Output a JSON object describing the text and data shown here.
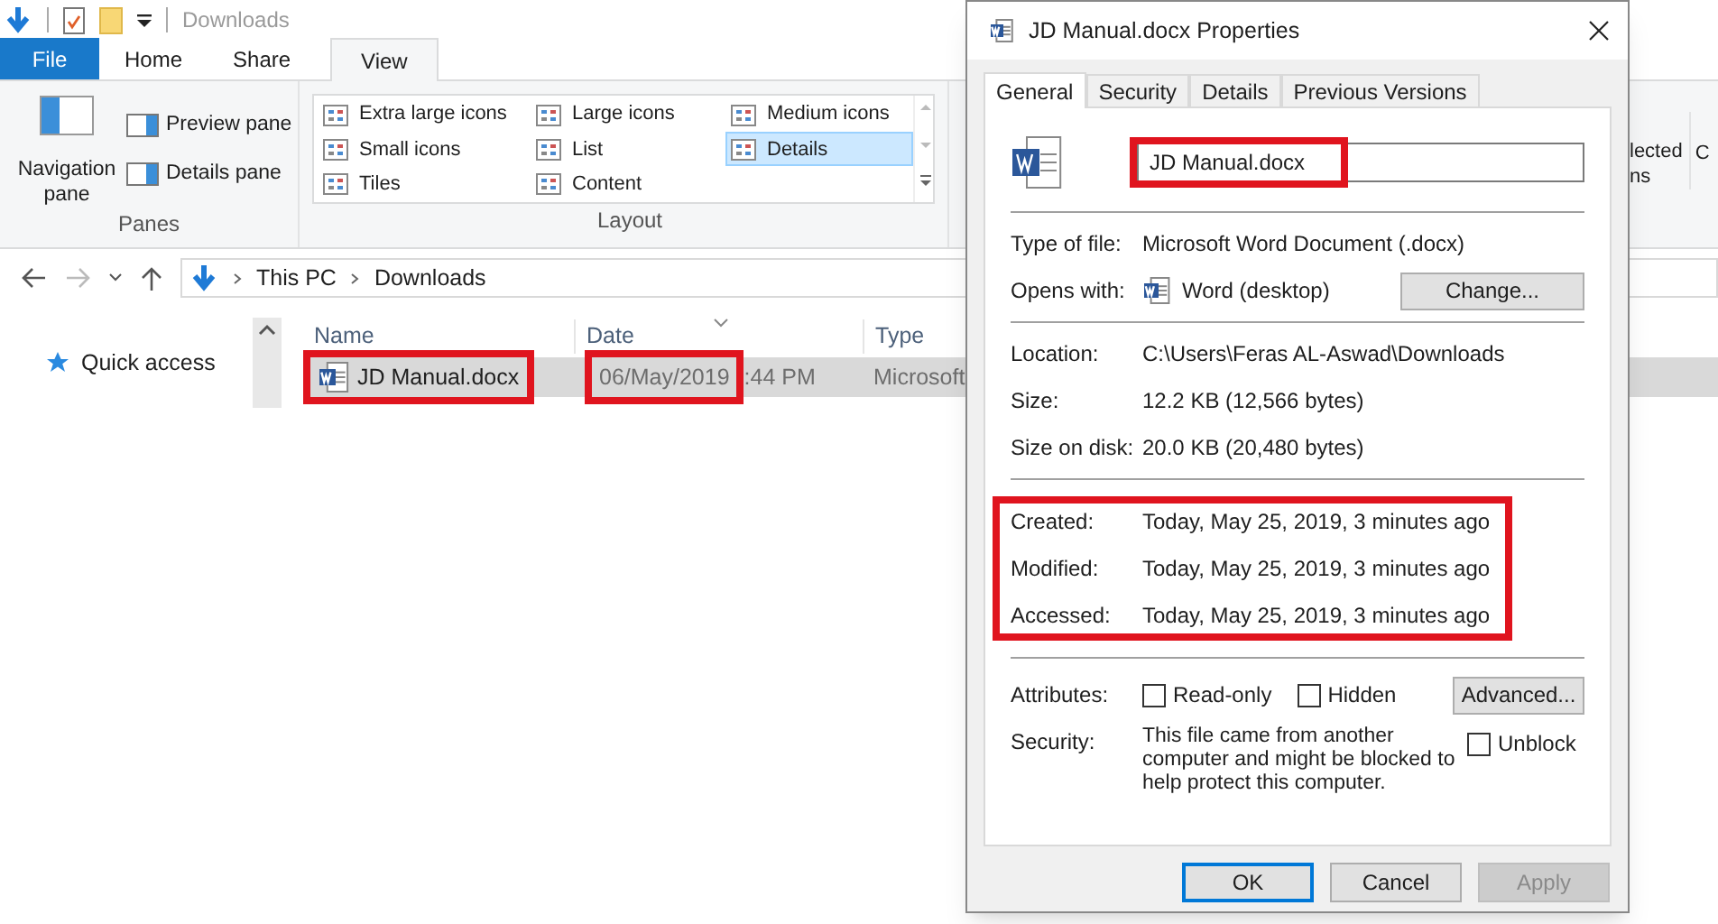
{
  "quick_access_toolbar": {
    "title": "Downloads"
  },
  "ribbon_tabs": [
    {
      "label": "File",
      "kind": "file",
      "selected": false
    },
    {
      "label": "Home",
      "kind": "tab",
      "selected": false
    },
    {
      "label": "Share",
      "kind": "tab",
      "selected": false
    },
    {
      "label": "View",
      "kind": "tab",
      "selected": true
    }
  ],
  "panes_group": {
    "label": "Panes",
    "navigation_pane": "Navigation pane",
    "buttons": [
      "Preview pane",
      "Details pane"
    ]
  },
  "layout_group": {
    "label": "Layout",
    "options": [
      {
        "label": "Extra large icons",
        "selected": false
      },
      {
        "label": "Large icons",
        "selected": false
      },
      {
        "label": "Medium icons",
        "selected": false
      },
      {
        "label": "Small icons",
        "selected": false
      },
      {
        "label": "List",
        "selected": false
      },
      {
        "label": "Details",
        "selected": true
      },
      {
        "label": "Tiles",
        "selected": false
      },
      {
        "label": "Content",
        "selected": false
      }
    ]
  },
  "hidden_button_fragment": [
    "lected",
    "ns"
  ],
  "hidden_group_fragment": "C",
  "address_bar": {
    "path": [
      "This PC",
      "Downloads"
    ]
  },
  "navigation": {
    "items": [
      {
        "label": "Quick access"
      }
    ]
  },
  "file_list": {
    "columns": [
      "Name",
      "Date",
      "Type"
    ],
    "rows": [
      {
        "name": "JD Manual.docx",
        "date": "06/May/2019",
        "time_fragment": ":44 PM",
        "type": "Microsoft",
        "selected": true,
        "name_highlighted": true,
        "date_highlighted": true
      }
    ]
  },
  "properties_dialog": {
    "title": "JD Manual.docx Properties",
    "tabs": [
      {
        "label": "General",
        "selected": true
      },
      {
        "label": "Security",
        "selected": false
      },
      {
        "label": "Details",
        "selected": false
      },
      {
        "label": "Previous Versions",
        "selected": false
      }
    ],
    "file_name": {
      "value": "JD Manual.docx",
      "highlighted": true
    },
    "sections": [
      {
        "highlighted": false,
        "rows": [
          {
            "label": "Type of file:",
            "value": "Microsoft Word Document (.docx)",
            "kind": "text"
          },
          {
            "label": "Opens with:",
            "value": "Word (desktop)",
            "kind": "app",
            "button": "Change..."
          }
        ]
      },
      {
        "highlighted": false,
        "rows": [
          {
            "label": "Location:",
            "value": "C:\\Users\\Feras AL-Aswad\\Downloads",
            "kind": "text"
          },
          {
            "label": "Size:",
            "value": "12.2 KB (12,566 bytes)",
            "kind": "text"
          },
          {
            "label": "Size on disk:",
            "value": "20.0 KB (20,480 bytes)",
            "kind": "text"
          }
        ]
      },
      {
        "highlighted": true,
        "rows": [
          {
            "label": "Created:",
            "value": "Today, May 25, 2019, 3 minutes ago",
            "kind": "text"
          },
          {
            "label": "Modified:",
            "value": "Today, May 25, 2019, 3 minutes ago",
            "kind": "text"
          },
          {
            "label": "Accessed:",
            "value": "Today, May 25, 2019, 3 minutes ago",
            "kind": "text"
          }
        ]
      }
    ],
    "attributes": {
      "label": "Attributes:",
      "checkboxes": [
        {
          "label": "Read-only",
          "checked": false
        },
        {
          "label": "Hidden",
          "checked": false
        }
      ],
      "button": "Advanced..."
    },
    "security": {
      "label": "Security:",
      "text": "This file came from another computer and might be blocked to help protect this computer.",
      "checkbox": {
        "label": "Unblock",
        "checked": false
      }
    },
    "buttons": [
      {
        "label": "OK",
        "kind": "default"
      },
      {
        "label": "Cancel",
        "kind": "normal"
      },
      {
        "label": "Apply",
        "kind": "disabled"
      }
    ]
  }
}
